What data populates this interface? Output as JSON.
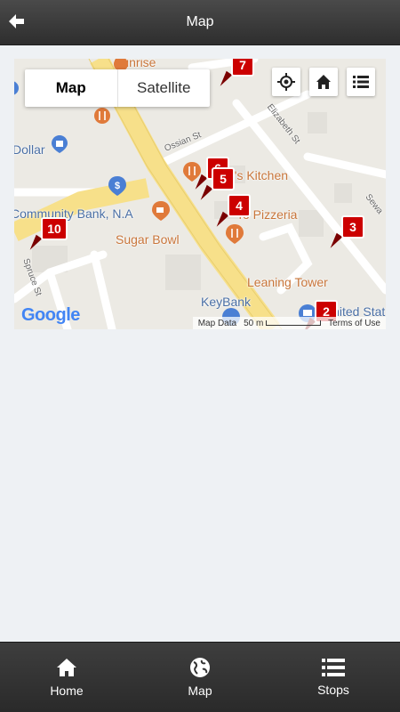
{
  "header": {
    "title": "Map",
    "back_icon": "back-arrow-icon"
  },
  "map": {
    "type_control": {
      "map_label": "Map",
      "satellite_label": "Satellite",
      "active": "Map"
    },
    "controls": [
      {
        "name": "locate-icon"
      },
      {
        "name": "home-icon"
      },
      {
        "name": "list-icon"
      }
    ],
    "poi_labels": {
      "sunrise": "Sunrise",
      "dollar": "Dollar",
      "kitchen": "g's Kitchen",
      "pizzeria": "To  Pizzeria",
      "community_bank": "Community Bank, N.A",
      "sugar_bowl": "Sugar Bowl",
      "leaning_tower": "Leaning Tower",
      "keybank": "KeyBank",
      "united_states": "United Stat"
    },
    "street_labels": {
      "ossian": "Ossian St",
      "elizabeth": "Elizabeth St",
      "spruce": "Spruce St",
      "sewa": "Sewa"
    },
    "markers": [
      "7",
      "6",
      "5",
      "4",
      "3",
      "10",
      "2"
    ],
    "logo": "Google",
    "footer": {
      "map_data": "Map Data",
      "scale": "50 m",
      "terms": "Terms of Use"
    }
  },
  "bottom_nav": [
    {
      "label": "Home",
      "icon": "home-icon"
    },
    {
      "label": "Map",
      "icon": "globe-icon"
    },
    {
      "label": "Stops",
      "icon": "list-icon"
    }
  ],
  "colors": {
    "marker": "#cc0000",
    "header": "#3a3a3a",
    "road_major": "#f7e08a",
    "road_minor": "#ffffff",
    "map_bg": "#eceae4"
  }
}
